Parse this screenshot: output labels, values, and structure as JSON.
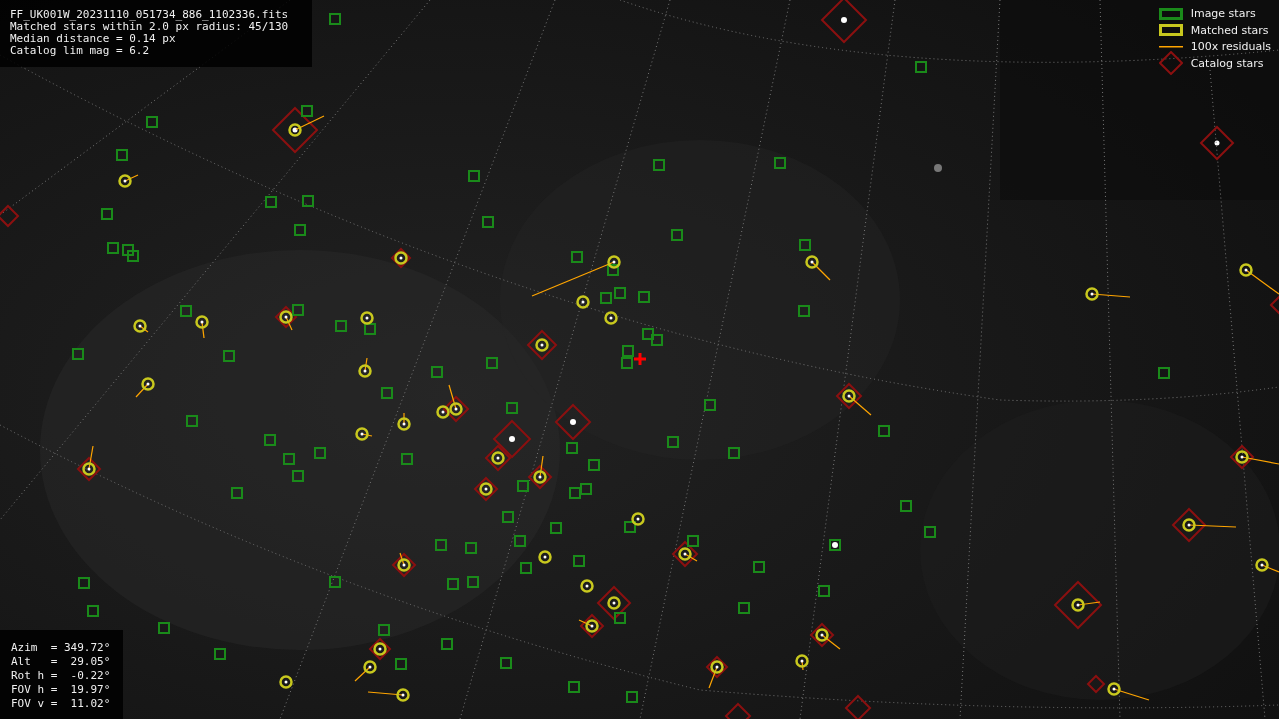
{
  "file_info": {
    "lines": [
      "FF_UK001W_20231110_051734_886_1102336.fits",
      "Matched stars within 2.0 px radius: 45/130",
      "Median distance = 0.14 px",
      "Catalog lim mag = 6.2"
    ]
  },
  "legend": [
    {
      "kind": "square",
      "color": "#1a8a1a",
      "label": "Image stars"
    },
    {
      "kind": "ring",
      "color": "#c8c81e",
      "label": "Matched stars"
    },
    {
      "kind": "line",
      "color": "#ffa500",
      "label": "100x residuals"
    },
    {
      "kind": "diamond",
      "color": "#8b1010",
      "label": "Catalog stars"
    }
  ],
  "pointing": {
    "lines": [
      "Azim  = 349.72°",
      "Alt   =  29.05°",
      "Rot h =  -0.22°",
      "FOV h =  19.97°",
      "FOV v =  11.02°"
    ]
  }
}
